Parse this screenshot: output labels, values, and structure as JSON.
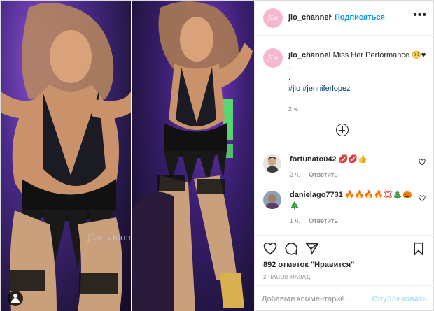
{
  "header": {
    "username": "jlo_channel",
    "separator": "•",
    "follow_label": "Подписаться",
    "more_icon": "more-dots-icon"
  },
  "photo": {
    "watermark": "jlo_channel"
  },
  "caption": {
    "username": "jlo_channel",
    "text": "Miss Her Performance 🥺♥",
    "line_dot_1": ".",
    "line_dot_2": ".",
    "hashtags": "#jlo #jenniferlopez",
    "time": "2 ч."
  },
  "comments": [
    {
      "username": "fortunato042",
      "text": "💋💋👍",
      "time": "2 ч.",
      "reply_label": "Ответить"
    },
    {
      "username": "danielago7731",
      "text": "🔥🔥🔥🔥💢🎄🎃🎄",
      "time": "1 ч.",
      "reply_label": "Ответить"
    }
  ],
  "actions": {
    "likes": "892 отметок \"Нравится\"",
    "posted": "2 ЧАСОВ НАЗАД",
    "comment_placeholder": "Добавьте комментарий...",
    "publish_label": "Опубликовать"
  },
  "colors": {
    "link_blue": "#0095f6",
    "hashtag_blue": "#00376b",
    "publish_disabled": "#b2dffc",
    "muted": "#8e8e8e"
  }
}
